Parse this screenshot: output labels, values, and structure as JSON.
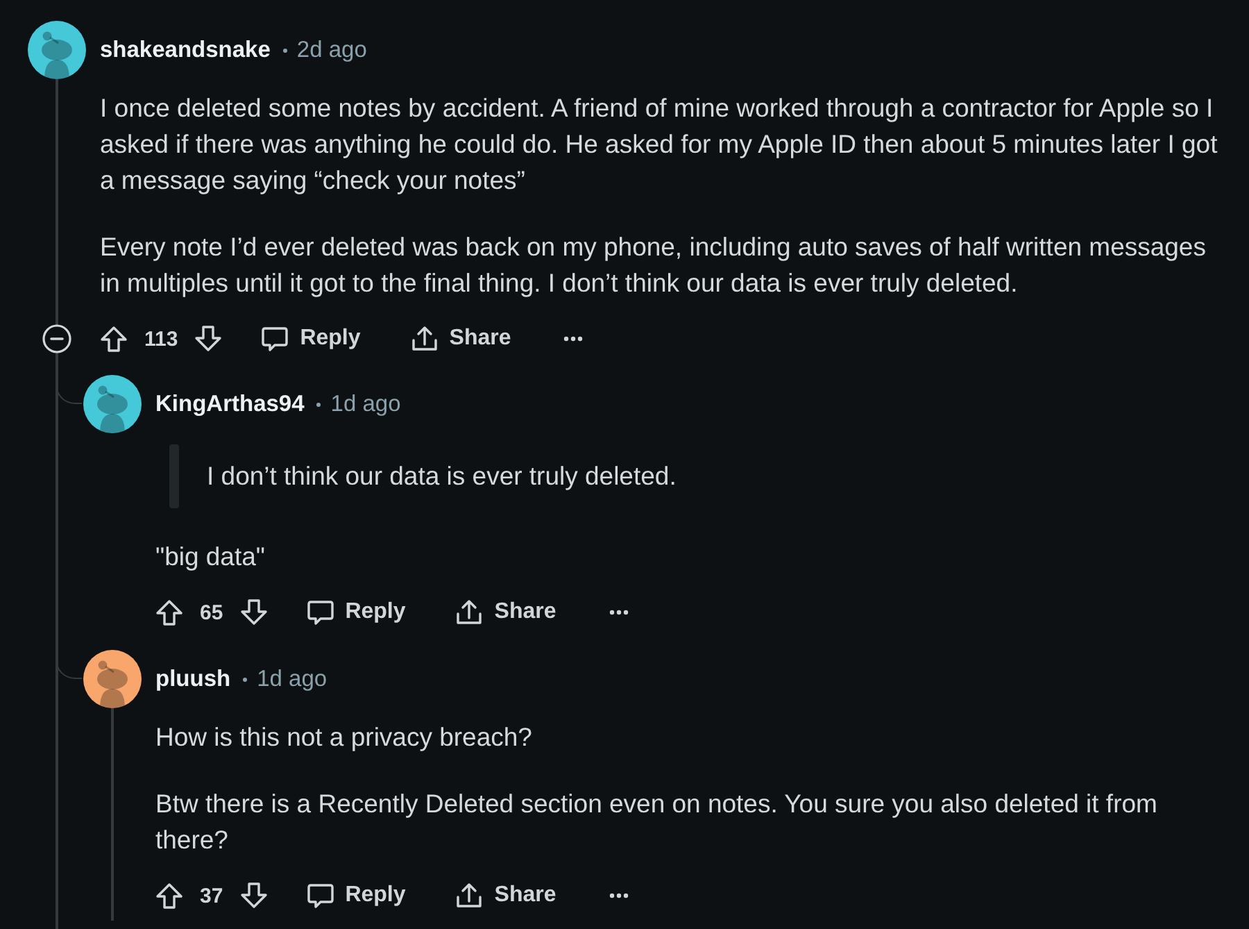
{
  "comments": [
    {
      "author": "shakeandsnake",
      "time": "2d ago",
      "color": "#45c8d8",
      "thread_line": true,
      "collapse_control": true,
      "paragraphs": [
        {
          "kind": "text",
          "text": "I once deleted some notes by accident. A friend of mine worked through a contractor for Apple so I asked if there was anything he could do. He asked for my Apple ID then about 5 minutes later I got a message saying “check your notes”"
        },
        {
          "kind": "text",
          "text": "Every note I’d ever deleted was back on my phone, including auto saves of half written messages in multiples until it got to the final thing. I don’t think our data is ever truly deleted."
        }
      ],
      "votes": "113",
      "reply_label": "Reply",
      "share_label": "Share",
      "children": [
        {
          "author": "KingArthas94",
          "time": "1d ago",
          "color": "#45c8d8",
          "thread_line": false,
          "collapse_control": false,
          "paragraphs": [
            {
              "kind": "quote",
              "text": "I don’t think our data is ever truly deleted."
            },
            {
              "kind": "text",
              "text": "\"big data\""
            }
          ],
          "votes": "65",
          "reply_label": "Reply",
          "share_label": "Share"
        },
        {
          "author": "pluush",
          "time": "1d ago",
          "color": "#f9a66c",
          "thread_line": true,
          "collapse_control": false,
          "paragraphs": [
            {
              "kind": "text",
              "text": "How is this not a privacy breach?"
            },
            {
              "kind": "text",
              "text": "Btw there is a Recently Deleted section even on notes. You sure you also deleted it from there?"
            }
          ],
          "votes": "37",
          "reply_label": "Reply",
          "share_label": "Share"
        }
      ]
    }
  ]
}
